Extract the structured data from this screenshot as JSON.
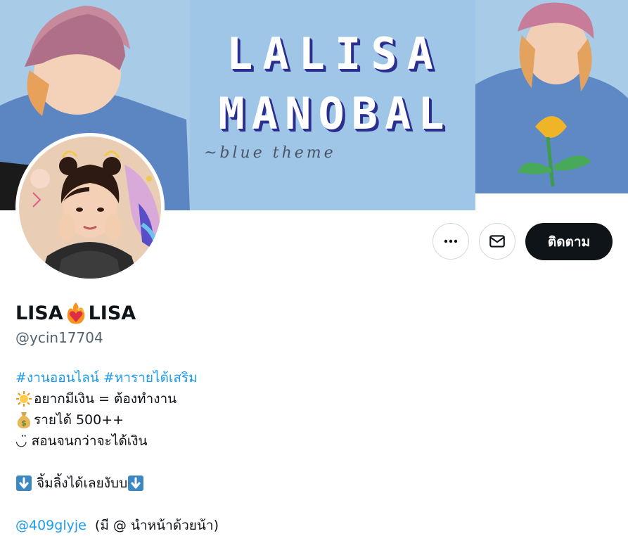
{
  "banner": {
    "title_line1": "LALISA",
    "title_line2": "MANOBAL",
    "subtitle": "~blue theme"
  },
  "actions": {
    "more_icon": "more-horizontal-icon",
    "message_icon": "envelope-icon",
    "follow_label": "ติดตาม"
  },
  "profile": {
    "name_part1": "LISA",
    "name_emoji": "heart-on-fire-icon",
    "name_part2": "LISA",
    "handle": "@ycin17704"
  },
  "bio": {
    "hashtag1": "#งานออนไลน์",
    "hashtag2": "#หารายได้เสริม",
    "line1_icon": "sun-icon",
    "line1_text": "อยากมีเงิน = ต้องทำงาน",
    "line2_icon": "money-bag-icon",
    "line2_text": "รายได้ 500++",
    "line3_symbol": "◡̈",
    "line3_text": "สอนจนกว่าจะได้เงิน",
    "line4_text": "จิ้มลิ้งได้เลยงับบ",
    "down_arrow_icon": "down-arrow-icon",
    "mention": "@409glyje",
    "mention_note": "(มี @ นำหน้าด้วยน้า)"
  }
}
